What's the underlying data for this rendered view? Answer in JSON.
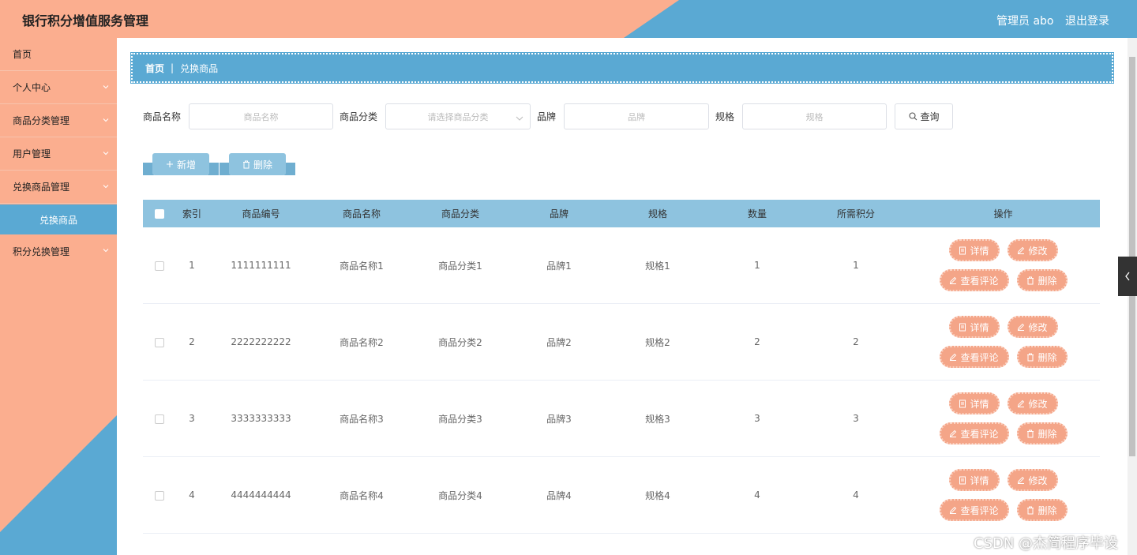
{
  "header": {
    "title": "银行积分增值服务管理",
    "admin": "管理员 abo",
    "logout": "退出登录"
  },
  "sidebar": {
    "items": [
      {
        "label": "首页"
      },
      {
        "label": "个人中心"
      },
      {
        "label": "商品分类管理"
      },
      {
        "label": "用户管理"
      },
      {
        "label": "兑换商品管理"
      },
      {
        "label": "兑换商品"
      },
      {
        "label": "积分兑换管理"
      }
    ]
  },
  "breadcrumb": {
    "home": "首页",
    "current": "兑换商品"
  },
  "search": {
    "name_label": "商品名称",
    "name_placeholder": "商品名称",
    "category_label": "商品分类",
    "category_placeholder": "请选择商品分类",
    "brand_label": "品牌",
    "brand_placeholder": "品牌",
    "spec_label": "规格",
    "spec_placeholder": "规格",
    "query_button": "查询"
  },
  "actions": {
    "add": "新增",
    "delete": "删除"
  },
  "table": {
    "headers": [
      "索引",
      "商品编号",
      "商品名称",
      "商品分类",
      "品牌",
      "规格",
      "数量",
      "所需积分",
      "操作"
    ],
    "rows": [
      {
        "idx": "1",
        "code": "1111111111",
        "name": "商品名称1",
        "cat": "商品分类1",
        "brand": "品牌1",
        "spec": "规格1",
        "qty": "1",
        "pts": "1"
      },
      {
        "idx": "2",
        "code": "2222222222",
        "name": "商品名称2",
        "cat": "商品分类2",
        "brand": "品牌2",
        "spec": "规格2",
        "qty": "2",
        "pts": "2"
      },
      {
        "idx": "3",
        "code": "3333333333",
        "name": "商品名称3",
        "cat": "商品分类3",
        "brand": "品牌3",
        "spec": "规格3",
        "qty": "3",
        "pts": "3"
      },
      {
        "idx": "4",
        "code": "4444444444",
        "name": "商品名称4",
        "cat": "商品分类4",
        "brand": "品牌4",
        "spec": "规格4",
        "qty": "4",
        "pts": "4"
      }
    ],
    "op_labels": {
      "detail": "详情",
      "edit": "修改",
      "comments": "查看评论",
      "delete": "删除"
    }
  },
  "watermark": "CSDN @杰简程序毕设",
  "colors": {
    "peach": "#fbae8f",
    "blue": "#5aa9d3",
    "light_blue": "#8ec3df",
    "pill": "#f4a588"
  }
}
